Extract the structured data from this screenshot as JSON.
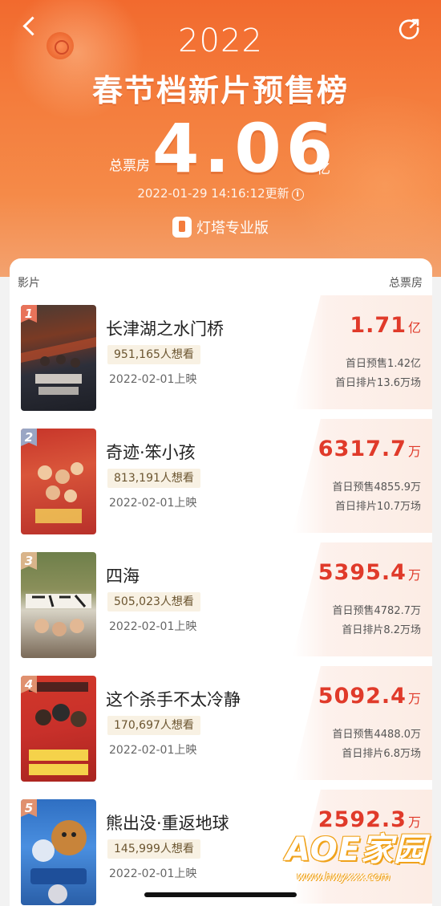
{
  "header": {
    "year": "2022",
    "title": "春节档新片预售榜",
    "total_label": "总票房",
    "total_value": "4.06",
    "total_unit": "亿",
    "update_time": "2022-01-29 14:16:12更新",
    "brand": "灯塔专业版"
  },
  "columns": {
    "film": "影片",
    "gross": "总票房"
  },
  "colors": {
    "accent": "#e03a2a",
    "hero": "#f47c3c",
    "rank1": "#e8735a",
    "rank2": "#9aa6c4",
    "rank3": "#d9b48a",
    "rank_other": "#e0916f"
  },
  "movies": [
    {
      "rank": "1",
      "name": "长津湖之水门桥",
      "want": "951,165人想看",
      "release": "2022-02-01上映",
      "gross_value": "1.71",
      "gross_unit": "亿",
      "presale": "首日预售1.42亿",
      "schedule": "首日排片13.6万场"
    },
    {
      "rank": "2",
      "name": "奇迹·笨小孩",
      "want": "813,191人想看",
      "release": "2022-02-01上映",
      "gross_value": "6317.7",
      "gross_unit": "万",
      "presale": "首日预售4855.9万",
      "schedule": "首日排片10.7万场"
    },
    {
      "rank": "3",
      "name": "四海",
      "want": "505,023人想看",
      "release": "2022-02-01上映",
      "gross_value": "5395.4",
      "gross_unit": "万",
      "presale": "首日预售4782.7万",
      "schedule": "首日排片8.2万场"
    },
    {
      "rank": "4",
      "name": "这个杀手不太冷静",
      "want": "170,697人想看",
      "release": "2022-02-01上映",
      "gross_value": "5092.4",
      "gross_unit": "万",
      "presale": "首日预售4488.0万",
      "schedule": "首日排片6.8万场"
    },
    {
      "rank": "5",
      "name": "熊出没·重返地球",
      "want": "145,999人想看",
      "release": "2022-02-01上映",
      "gross_value": "2592.3",
      "gross_unit": "万",
      "presale": "",
      "schedule": ""
    }
  ],
  "watermark": {
    "main": "AOE家园",
    "sub": "www.hwyxxx.com"
  }
}
